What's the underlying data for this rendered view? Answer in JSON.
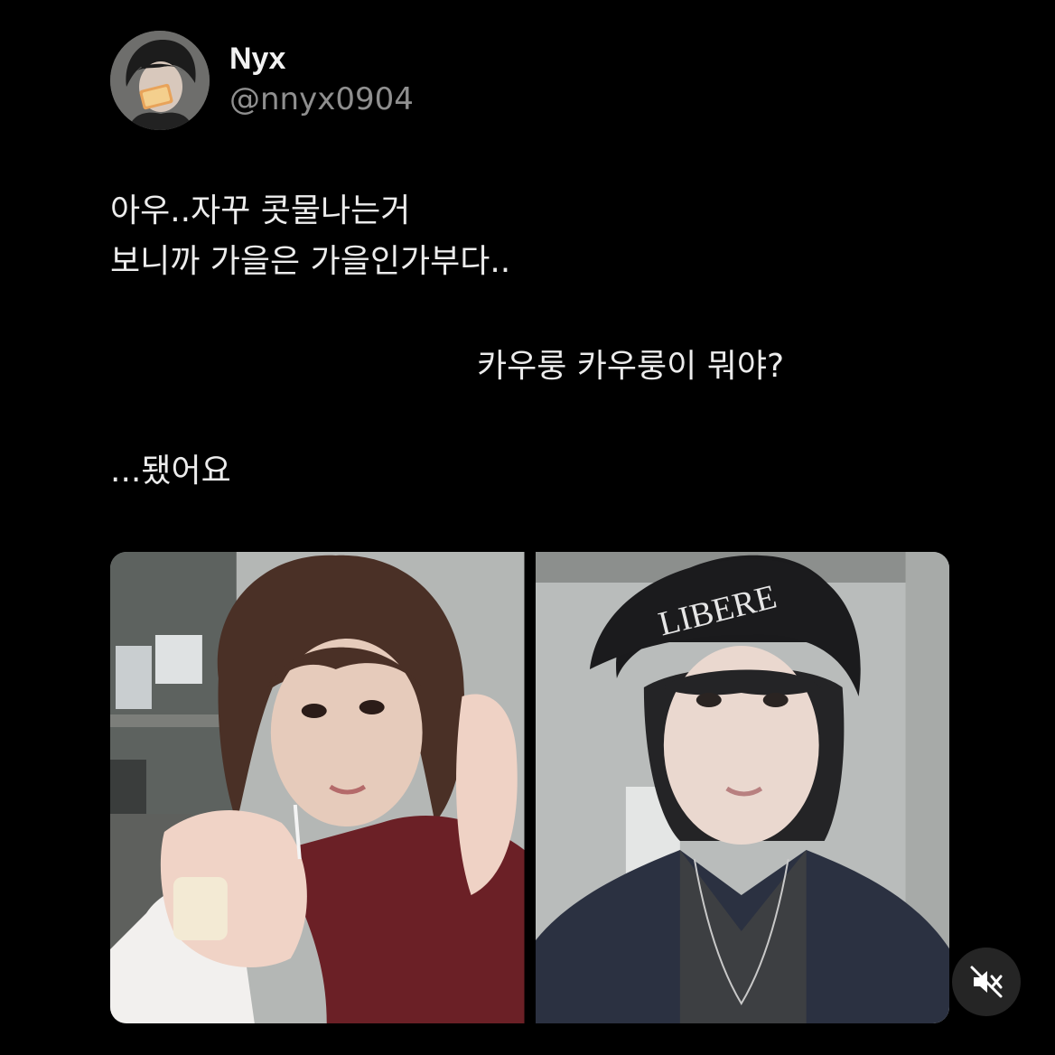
{
  "author": {
    "display_name": "Nyx",
    "handle": "@nnyx0904",
    "avatar": "avatar-image"
  },
  "post": {
    "text_1": "아우..자꾸 콧물나는거\n보니까 가을은 가을인가부다..",
    "text_2": "카우룽 카우룽이 뭐야?",
    "text_3": "...됐어요"
  },
  "media": {
    "photos": [
      {
        "name": "photo-left"
      },
      {
        "name": "photo-right",
        "visible_text": "LIBERE"
      }
    ],
    "sound_icon": "mute-icon"
  },
  "colors": {
    "background": "#000000",
    "text_primary": "#ececec",
    "text_secondary": "#8f8f8f"
  }
}
